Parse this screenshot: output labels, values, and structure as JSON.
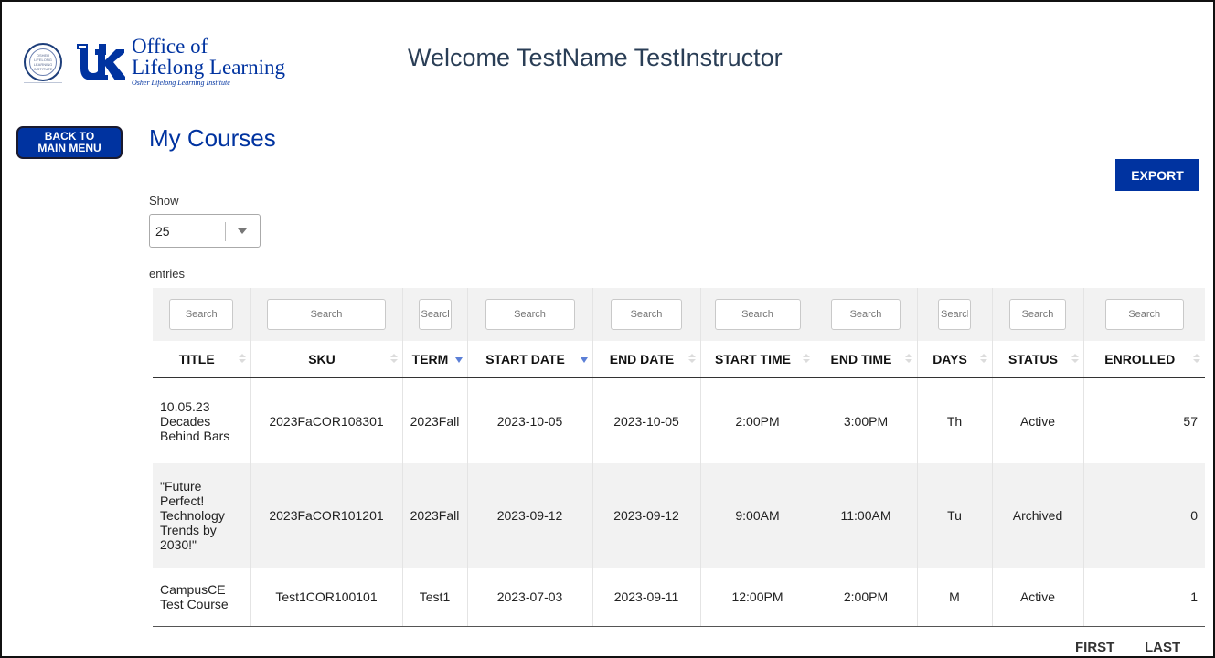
{
  "header": {
    "seal_text": "OSHER LIFELONG LEARNING INSTITUTE",
    "logo_line1": "Office of",
    "logo_line2": "Lifelong Learning",
    "logo_line3": "Osher Lifelong Learning Institute",
    "welcome": "Welcome TestName TestInstructor"
  },
  "nav": {
    "back_line1": "BACK TO",
    "back_line2": "MAIN MENU"
  },
  "page": {
    "title": "My Courses",
    "export_label": "EXPORT",
    "show_label": "Show",
    "show_value": "25",
    "entries_label": "entries"
  },
  "table": {
    "search_placeholders": [
      "Search",
      "Search",
      "Search",
      "Search",
      "Search",
      "Search",
      "Search",
      "Search",
      "Search",
      "Search"
    ],
    "columns": [
      "TITLE",
      "SKU",
      "TERM",
      "START DATE",
      "END DATE",
      "START TIME",
      "END TIME",
      "DAYS",
      "STATUS",
      "ENROLLED"
    ],
    "sorted_columns": [
      "TERM",
      "START DATE"
    ],
    "rows": [
      [
        "10.05.23 Decades Behind Bars",
        "2023FaCOR108301",
        "2023Fall",
        "2023-10-05",
        "2023-10-05",
        "2:00PM",
        "3:00PM",
        "Th",
        "Active",
        "57"
      ],
      [
        "\"Future Perfect! Technology Trends by 2030!\"",
        "2023FaCOR101201",
        "2023Fall",
        "2023-09-12",
        "2023-09-12",
        "9:00AM",
        "11:00AM",
        "Tu",
        "Archived",
        "0"
      ],
      [
        "CampusCE Test Course",
        "Test1COR100101",
        "Test1",
        "2023-07-03",
        "2023-09-11",
        "12:00PM",
        "2:00PM",
        "M",
        "Active",
        "1"
      ]
    ]
  },
  "pagination": {
    "first_label": "FIRST",
    "last_label": "LAST"
  },
  "colors": {
    "brand_blue": "#0033a0",
    "welcome_text": "#2a3e56",
    "sort_active": "#5b7fd6"
  }
}
